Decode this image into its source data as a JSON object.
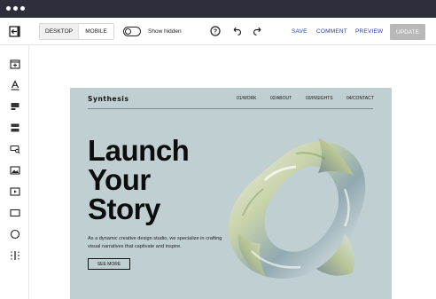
{
  "toolbar": {
    "desktop_label": "DESKTOP",
    "mobile_label": "MOBILE",
    "show_hidden_label": "Show hidden",
    "save_label": "SAVE",
    "comment_label": "COMMENT",
    "preview_label": "PREVIEW",
    "update_label": "UPDATE",
    "selected_view": "DESKTOP",
    "show_hidden_on": false
  },
  "sidebar": {
    "items": [
      {
        "icon": "add-section-icon"
      },
      {
        "icon": "text-icon"
      },
      {
        "icon": "paragraph-icon"
      },
      {
        "icon": "list-icon"
      },
      {
        "icon": "search-field-icon"
      },
      {
        "icon": "image-icon"
      },
      {
        "icon": "video-icon"
      },
      {
        "icon": "rectangle-icon"
      },
      {
        "icon": "circle-icon"
      },
      {
        "icon": "columns-icon"
      }
    ]
  },
  "site": {
    "logo": "Synthesis",
    "nav": [
      "01/WORK",
      "02/ABOUT",
      "03/INSIGHTS",
      "04/CONTACT"
    ],
    "headline": [
      "Launch",
      "Your",
      "Story"
    ],
    "description": "As a dynamic creative design studio, we specialize in crafting visual narratives that captivate and inspire.",
    "cta_label": "SEE MORE"
  },
  "colors": {
    "titlebar": "#2e2e3d",
    "accent_link": "#2b3ea0",
    "update_button": "#b8b8b8",
    "site_background": "#c0d0d2"
  }
}
